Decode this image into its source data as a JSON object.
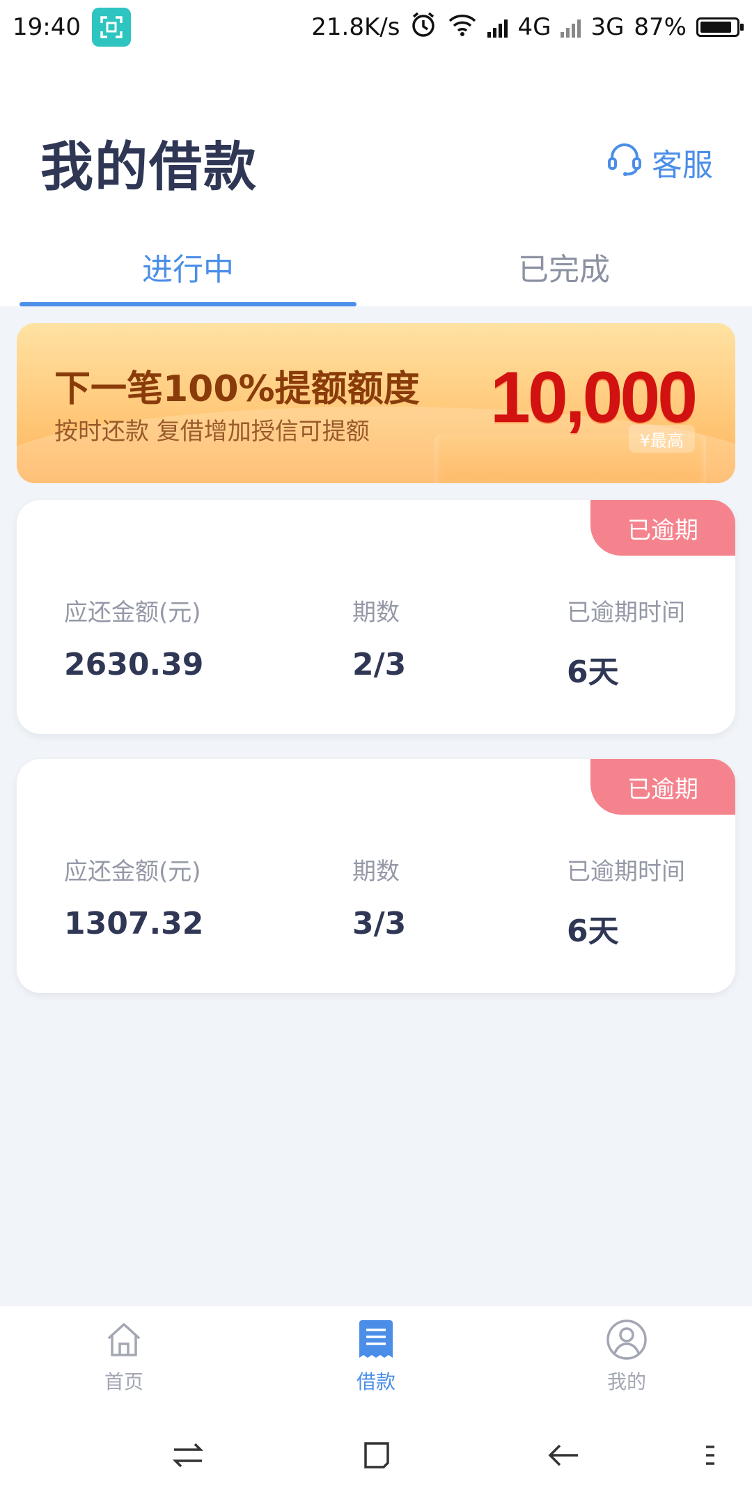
{
  "status_bar": {
    "time": "19:40",
    "net_speed": "21.8K/s",
    "net1": "4G",
    "net2": "3G",
    "battery": "87%",
    "battery_level": 0.87
  },
  "header": {
    "title": "我的借款",
    "service_label": "客服"
  },
  "tabs": [
    {
      "label": "进行中",
      "active": true
    },
    {
      "label": "已完成",
      "active": false
    }
  ],
  "banner": {
    "headline": "下一笔100%提额额度",
    "sub": "按时还款  复借增加授信可提额",
    "amount": "10,000",
    "max_label": "¥最高"
  },
  "loans": [
    {
      "status": "已逾期",
      "amount_label": "应还金额(元)",
      "amount": "2630.39",
      "period_label": "期数",
      "period": "2/3",
      "overdue_label": "已逾期时间",
      "overdue": "6天"
    },
    {
      "status": "已逾期",
      "amount_label": "应还金额(元)",
      "amount": "1307.32",
      "period_label": "期数",
      "period": "3/3",
      "overdue_label": "已逾期时间",
      "overdue": "6天"
    }
  ],
  "bottom_nav": [
    {
      "label": "首页",
      "icon": "home-icon",
      "active": false
    },
    {
      "label": "借款",
      "icon": "loan-document-icon",
      "active": true
    },
    {
      "label": "我的",
      "icon": "profile-icon",
      "active": false
    }
  ],
  "colors": {
    "accent": "#4b8ee8",
    "overdue": "#f5838d",
    "amount_red": "#d21111"
  }
}
